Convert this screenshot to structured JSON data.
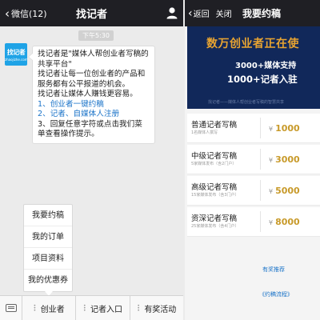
{
  "chat": {
    "back_label": "微信(12)",
    "title": "找记者",
    "time": "下午5:30",
    "avatar": {
      "brand": "找记者",
      "url": "zhaojizhe.com"
    },
    "message": {
      "line1": "找记者是\"媒体人帮创业者写稿的",
      "line2": "共享平台\"",
      "line3": "找记者让每一位创业者的产品和",
      "line4": "服务都有公平报道的机会。",
      "line5": "找记者让媒体人赚钱更容易。",
      "item1": "1、创业者一键约稿",
      "item2": "2、记者、自媒体人注册",
      "item3a": "3、回复任意字符或点击我们菜",
      "item3b": "单查看操作提示。"
    },
    "popup_menu": [
      "我要约稿",
      "我的订单",
      "项目资料",
      "我的优惠券"
    ],
    "bottom_menu": [
      "创业者",
      "记者入口",
      "有奖活动"
    ]
  },
  "webview": {
    "back_label": "返回",
    "close_label": "关闭",
    "title": "我要约稿",
    "banner": {
      "headline": "数万创业者正在使",
      "line1": "3000+媒体支持",
      "line2": "1000+记者入驻",
      "footer": "找记者——媒体人帮创业者写稿的智慧共享"
    },
    "offers": [
      {
        "name": "普通记者写稿",
        "desc": "1名媒体人撰写",
        "price": "1000"
      },
      {
        "name": "中级记者写稿",
        "desc": "5家媒体发布（含2门户）",
        "price": "3000"
      },
      {
        "name": "高级记者写稿",
        "desc": "15家媒体发布（含3门户）",
        "price": "5000"
      },
      {
        "name": "资深记者写稿",
        "desc": "25家媒体发布（含4门户）",
        "price": "8000"
      }
    ],
    "currency_symbol": "¥",
    "link_recommend": "有奖推荐",
    "link_process": "《约稿流程》"
  },
  "colors": {
    "topbar": "#1f1f24",
    "banner_bg": "#11285a",
    "banner_headline": "#e8a431",
    "price": "#c89a2a",
    "link": "#1a73c8",
    "avatar": "#1fa3e6"
  },
  "icons": [
    "chevron-left-icon",
    "person-icon",
    "keyboard-icon",
    "menu-dots-icon"
  ]
}
